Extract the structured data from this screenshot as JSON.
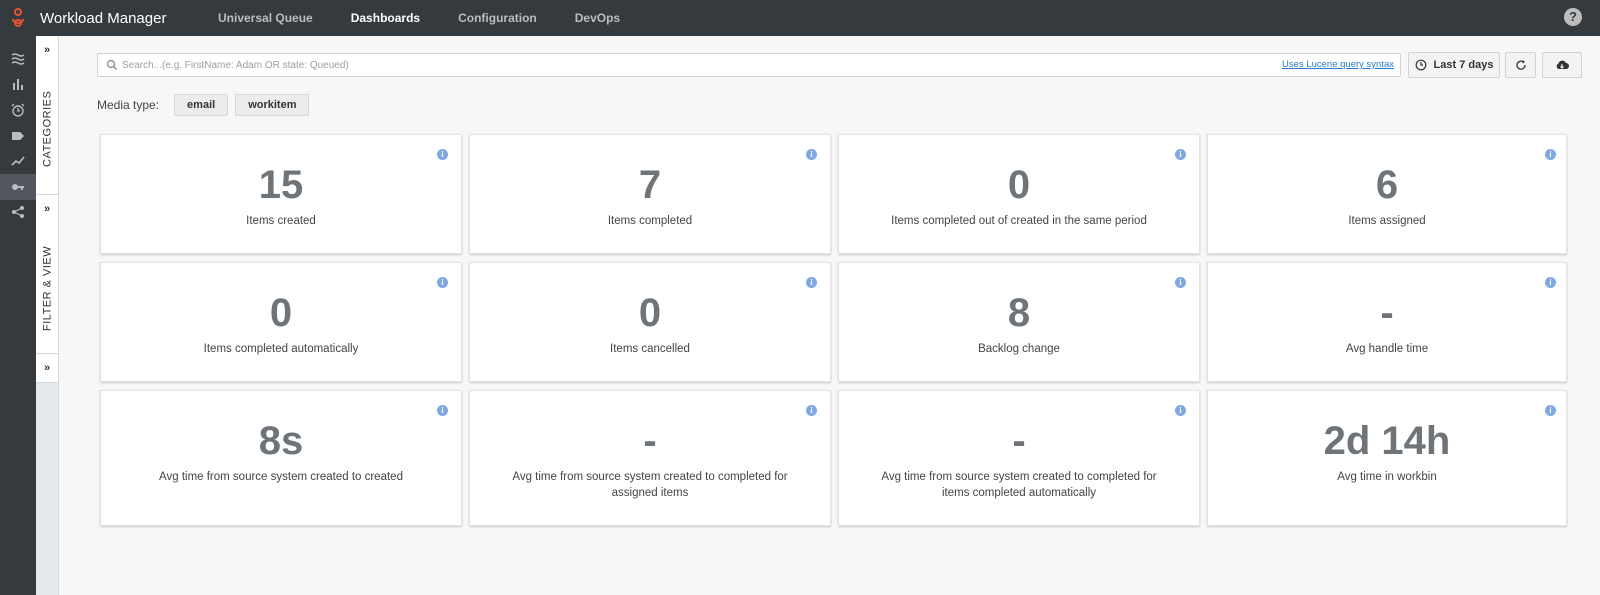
{
  "app": {
    "title": "Workload Manager",
    "help": "?"
  },
  "nav": [
    {
      "label": "Universal Queue",
      "active": false
    },
    {
      "label": "Dashboards",
      "active": true
    },
    {
      "label": "Configuration",
      "active": false
    },
    {
      "label": "DevOps",
      "active": false
    }
  ],
  "rail_icons": [
    "queues-icon",
    "bar-chart-icon",
    "alarm-clock-icon",
    "tag-icon",
    "trend-line-icon",
    "key-icon",
    "share-icon"
  ],
  "sidepanel": {
    "chevron": "»",
    "categories": "CATEGORIES",
    "filter_view": "FILTER & VIEW"
  },
  "search": {
    "placeholder": "Search...(e.g. FirstName: Adam OR state: Queued)",
    "lucene_link": "Uses Lucene query syntax"
  },
  "toolbar": {
    "range_label": "Last 7 days"
  },
  "media": {
    "label": "Media type:",
    "chips": [
      "email",
      "workitem"
    ]
  },
  "cards": [
    {
      "value": "15",
      "label": "Items created"
    },
    {
      "value": "7",
      "label": "Items completed"
    },
    {
      "value": "0",
      "label": "Items completed out of created in the same period"
    },
    {
      "value": "6",
      "label": "Items assigned"
    },
    {
      "value": "0",
      "label": "Items completed automatically"
    },
    {
      "value": "0",
      "label": "Items cancelled"
    },
    {
      "value": "8",
      "label": "Backlog change"
    },
    {
      "value": "-",
      "label": "Avg handle time"
    },
    {
      "value": "8s",
      "label": "Avg time from source system created to created"
    },
    {
      "value": "-",
      "label": "Avg time from source system created to completed for assigned items"
    },
    {
      "value": "-",
      "label": "Avg time from source system created to completed for items completed automatically"
    },
    {
      "value": "2d 14h",
      "label": "Avg time in workbin"
    }
  ],
  "colors": {
    "topbar": "#353a3f",
    "accent": "#2a7bd4",
    "logo": "#e8542f",
    "info": "#7ea9e6"
  }
}
